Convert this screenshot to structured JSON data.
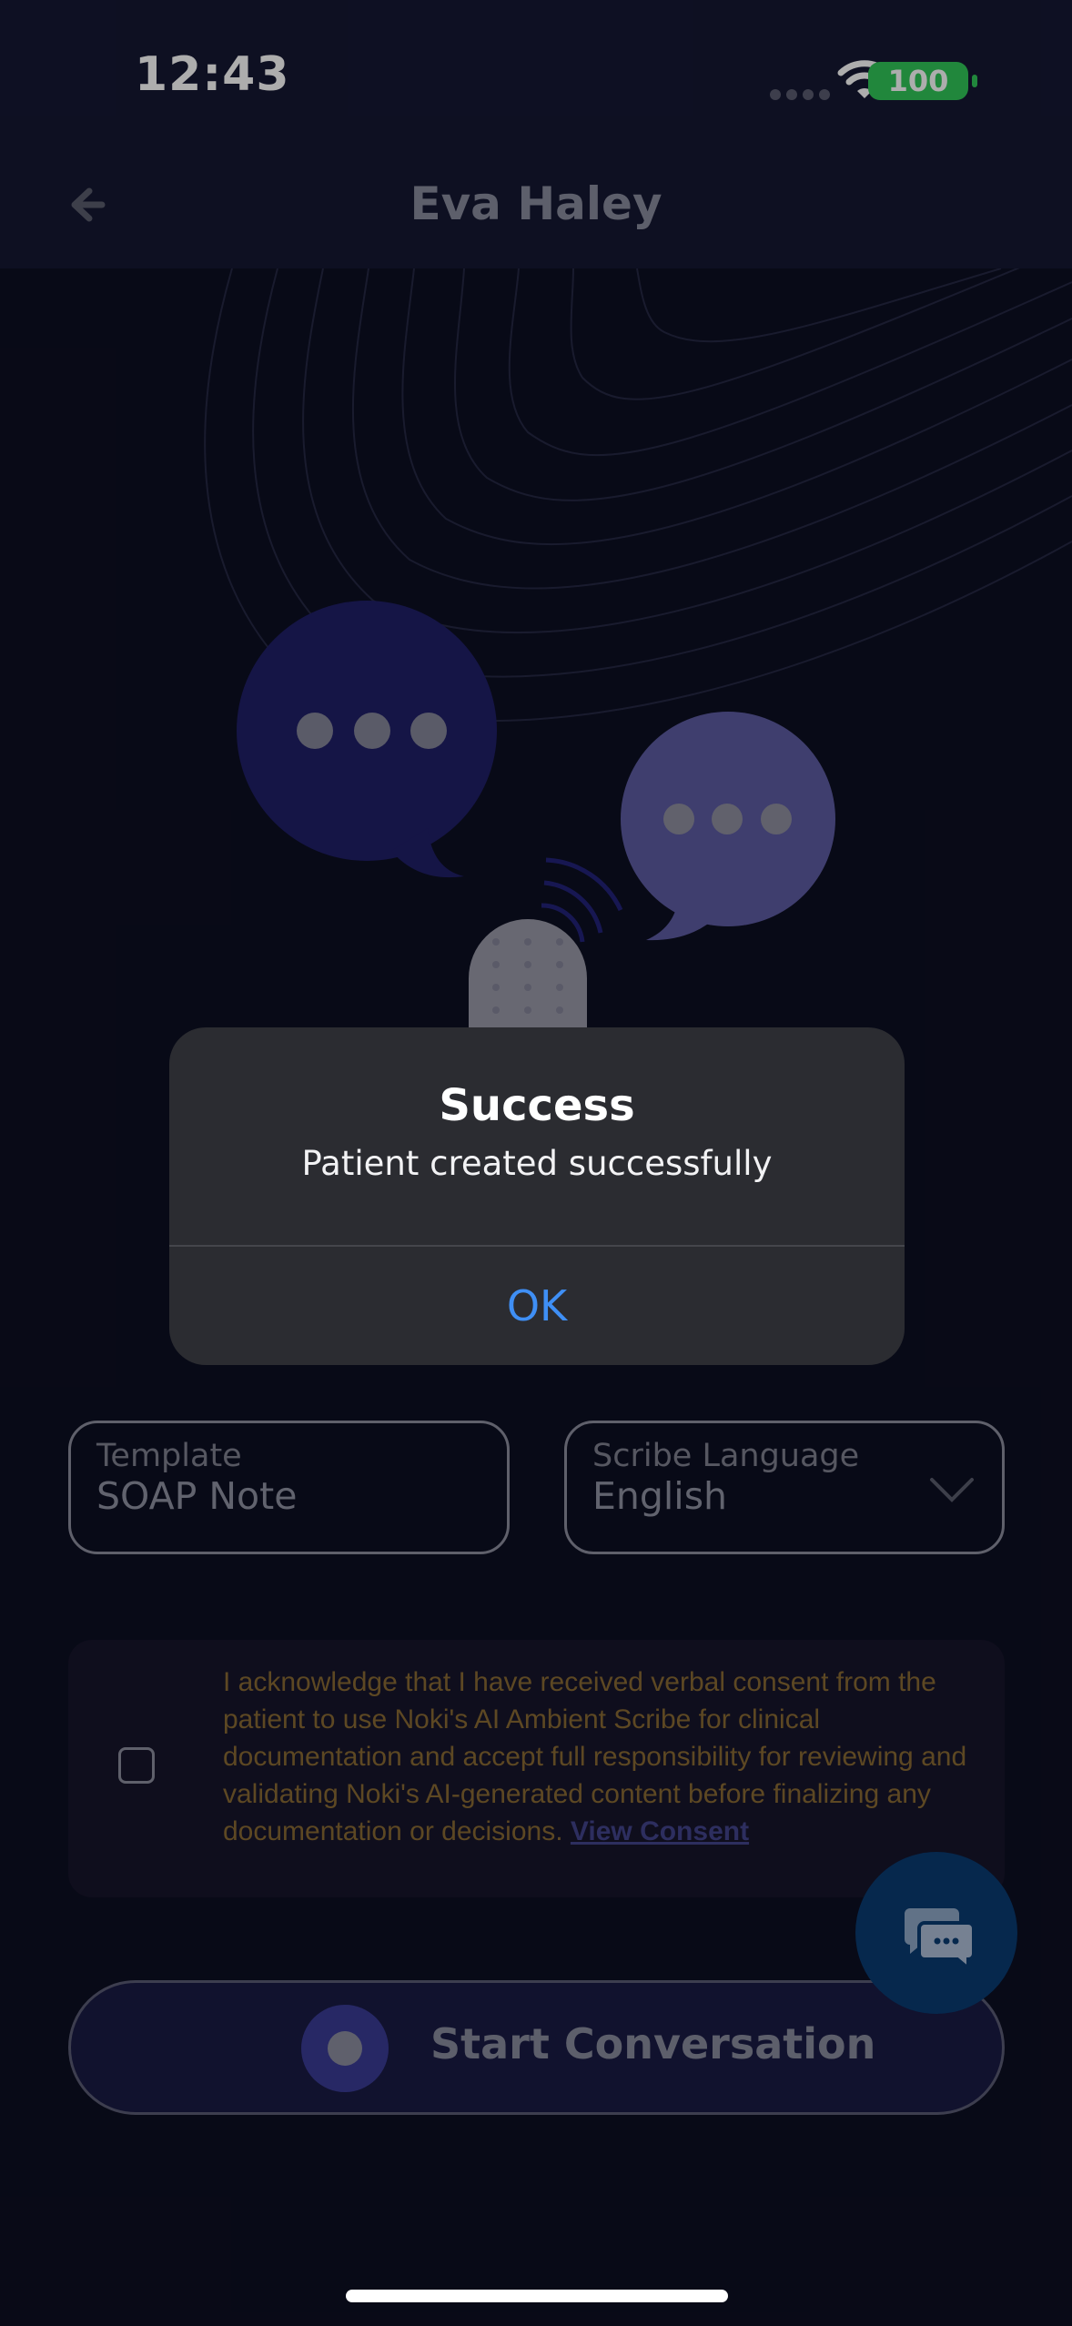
{
  "status_bar": {
    "time": "12:43",
    "battery": "100"
  },
  "header": {
    "title": "Eva Haley"
  },
  "form": {
    "template": {
      "label": "Template",
      "value": "SOAP Note"
    },
    "language": {
      "label": "Scribe Language",
      "value": "English"
    }
  },
  "consent": {
    "text": "I acknowledge that I have received verbal consent from the patient to use Noki's AI Ambient Scribe for clinical documentation and accept full responsibility for reviewing and validating Noki's AI-generated content before finalizing any documentation or decisions.",
    "link": "View Consent"
  },
  "start_button": {
    "label": "Start Conversation"
  },
  "alert": {
    "title": "Success",
    "message": "Patient created successfully",
    "ok": "OK"
  },
  "icons": [
    "back-arrow-icon",
    "wifi-icon",
    "chevron-down-icon",
    "record-icon",
    "chat-icon"
  ],
  "colors": {
    "background": "#0d0f22",
    "accent_blue": "#3f8ff5",
    "battery_green": "#32c759",
    "consent_text": "#8a6a34"
  }
}
